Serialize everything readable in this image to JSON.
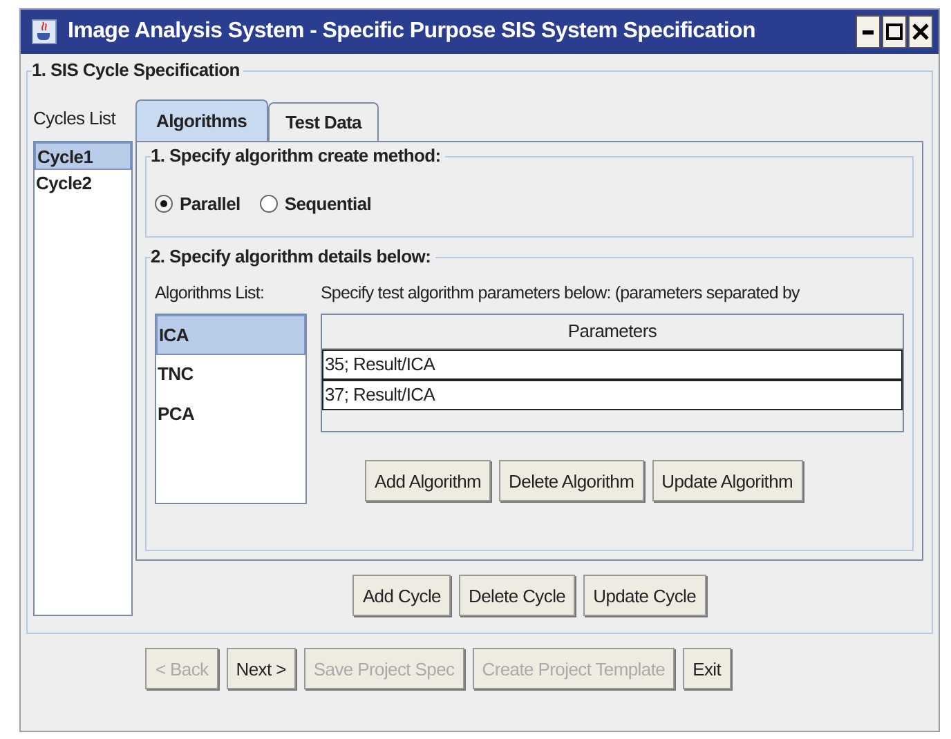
{
  "window": {
    "title": "Image Analysis System - Specific Purpose SIS System Specification"
  },
  "section": {
    "title": "1. SIS Cycle Specification"
  },
  "cycles": {
    "label": "Cycles List",
    "items": [
      {
        "name": "Cycle1",
        "selected": true
      },
      {
        "name": "Cycle2",
        "selected": false
      }
    ]
  },
  "tabs": [
    {
      "label": "Algorithms",
      "selected": true
    },
    {
      "label": "Test Data",
      "selected": false
    }
  ],
  "method": {
    "title": "1. Specify algorithm create method:",
    "options": [
      {
        "label": "Parallel",
        "selected": true
      },
      {
        "label": "Sequential",
        "selected": false
      }
    ]
  },
  "details": {
    "title": "2. Specify algorithm details below:",
    "list_label": "Algorithms List:",
    "algorithms": [
      {
        "name": "ICA",
        "selected": true
      },
      {
        "name": "TNC",
        "selected": false
      },
      {
        "name": "PCA",
        "selected": false
      }
    ],
    "params_label": "Specify test algorithm parameters below: (parameters separated by",
    "table": {
      "columns": [
        "Parameters"
      ],
      "rows": [
        "35; Result/ICA",
        "37; Result/ICA"
      ]
    },
    "buttons": [
      {
        "label": "Add Algorithm",
        "disabled": false
      },
      {
        "label": "Delete Algorithm",
        "disabled": false
      },
      {
        "label": "Update Algorithm",
        "disabled": false
      }
    ]
  },
  "cycle_buttons": [
    {
      "label": "Add Cycle",
      "disabled": false
    },
    {
      "label": "Delete Cycle",
      "disabled": false
    },
    {
      "label": "Update Cycle",
      "disabled": false
    }
  ],
  "nav_buttons": [
    {
      "label": "< Back",
      "disabled": true
    },
    {
      "label": "Next >",
      "disabled": false
    },
    {
      "label": "Save Project Spec",
      "disabled": true
    },
    {
      "label": "Create Project Template",
      "disabled": true
    },
    {
      "label": "Exit",
      "disabled": false
    }
  ]
}
